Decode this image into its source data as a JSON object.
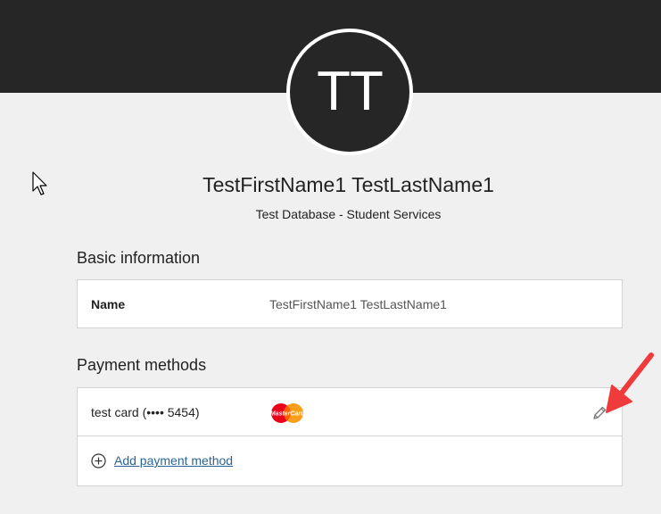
{
  "profile": {
    "initials": "TT",
    "name": "TestFirstName1 TestLastName1",
    "organization": "Test Database - Student Services"
  },
  "basic_information": {
    "heading": "Basic information",
    "fields": [
      {
        "label": "Name",
        "value": "TestFirstName1 TestLastName1"
      }
    ]
  },
  "payment_methods": {
    "heading": "Payment methods",
    "items": [
      {
        "label": "test card (•••• 5454)",
        "brand": "MasterCard",
        "brand_icon": "mastercard-icon"
      }
    ],
    "add_label": "Add payment method",
    "edit_icon": "pencil-icon",
    "add_icon": "plus-circle-icon"
  },
  "colors": {
    "banner": "#262626",
    "background": "#f0f0f0",
    "link": "#2a6496",
    "annotation_arrow": "#ef3b3b",
    "mastercard_red": "#eb001b",
    "mastercard_orange": "#f79e1b"
  }
}
